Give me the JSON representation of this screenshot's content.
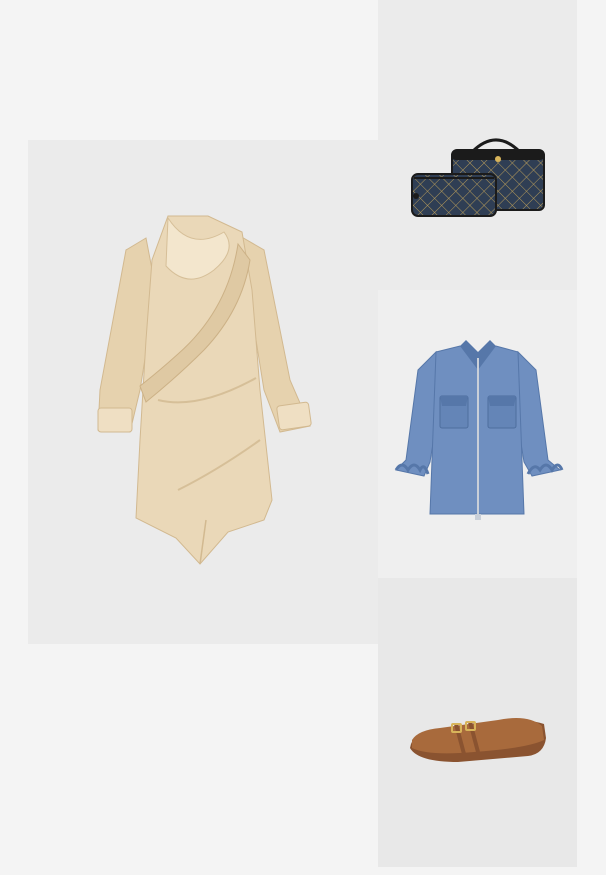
{
  "products": [
    {
      "id": "dress",
      "icon": "draped-satin-dress-image",
      "colors": {
        "base": "#ead8b8",
        "shade": "#d6bf98",
        "light": "#f3e6cd"
      }
    },
    {
      "id": "bags",
      "icon": "quilted-vanity-cases-image",
      "colors": {
        "base": "#2f3e54",
        "pattern": "#b59a5a",
        "trim": "#1b1b1b"
      }
    },
    {
      "id": "jacket",
      "icon": "denim-zip-jacket-image",
      "colors": {
        "base": "#6f8fc0",
        "shade": "#5677a9",
        "zipper": "#c9cfd8"
      }
    },
    {
      "id": "shoes",
      "icon": "suede-ballet-flat-image",
      "colors": {
        "base": "#a86a3c",
        "shade": "#8a5330",
        "buckle": "#d8b45a"
      }
    }
  ]
}
